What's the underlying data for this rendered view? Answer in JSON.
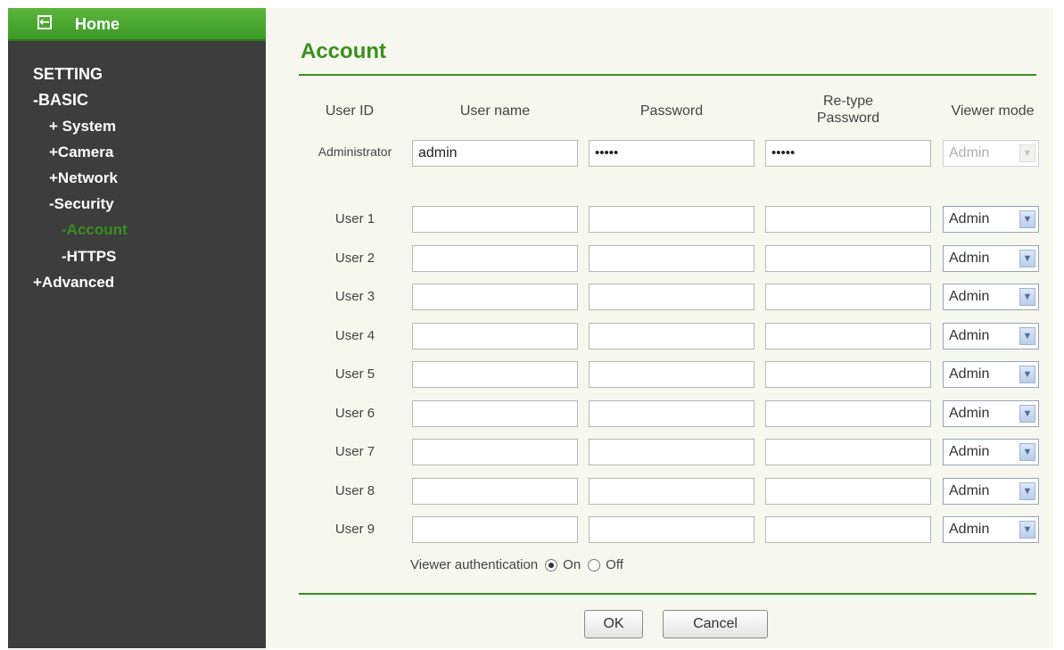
{
  "sidebar": {
    "home_label": "Home",
    "items": [
      {
        "label": "SETTING"
      },
      {
        "label": "-BASIC"
      },
      {
        "label": "+ System"
      },
      {
        "label": "+Camera"
      },
      {
        "label": "+Network"
      },
      {
        "label": "-Security"
      },
      {
        "label": "-Account"
      },
      {
        "label": "-HTTPS"
      },
      {
        "label": "+Advanced"
      }
    ]
  },
  "main": {
    "title": "Account",
    "headers": {
      "user_id": "User ID",
      "user_name": "User name",
      "password": "Password",
      "retype_password": "Re-type\nPassword",
      "viewer_mode": "Viewer mode"
    },
    "admin_row": {
      "label": "Administrator",
      "user_name": "admin",
      "password": "•••••",
      "retype": "•••••",
      "viewer_mode": "Admin"
    },
    "users": [
      {
        "label": "User 1",
        "viewer_mode": "Admin"
      },
      {
        "label": "User 2",
        "viewer_mode": "Admin"
      },
      {
        "label": "User 3",
        "viewer_mode": "Admin"
      },
      {
        "label": "User 4",
        "viewer_mode": "Admin"
      },
      {
        "label": "User 5",
        "viewer_mode": "Admin"
      },
      {
        "label": "User 6",
        "viewer_mode": "Admin"
      },
      {
        "label": "User 7",
        "viewer_mode": "Admin"
      },
      {
        "label": "User 8",
        "viewer_mode": "Admin"
      },
      {
        "label": "User 9",
        "viewer_mode": "Admin"
      }
    ],
    "viewer_auth": {
      "label": "Viewer authentication",
      "on": "On",
      "off": "Off",
      "selected": "On"
    },
    "buttons": {
      "ok": "OK",
      "cancel": "Cancel"
    }
  },
  "colors": {
    "accent": "#3a8f1e",
    "sidebar_bg": "#3d3d3d",
    "content_bg": "#f6f8f0"
  },
  "icons": {
    "home": "back-arrow-icon"
  }
}
